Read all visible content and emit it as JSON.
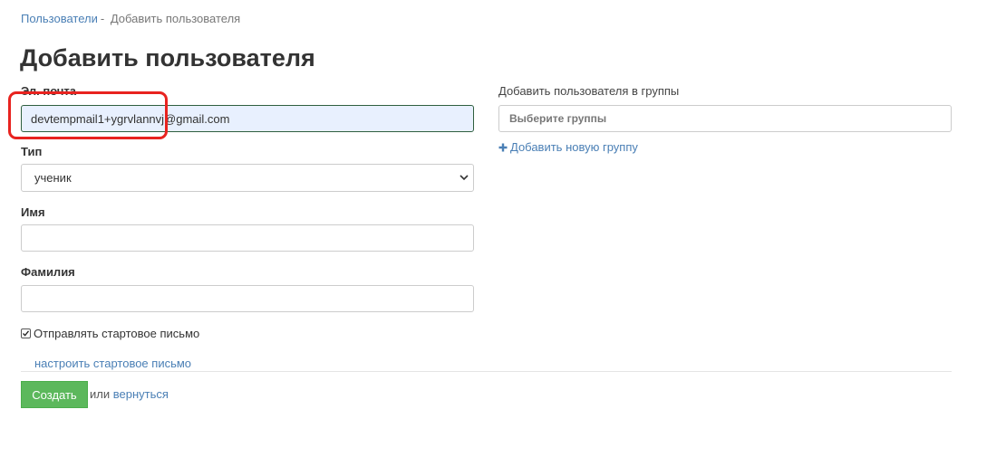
{
  "breadcrumb": {
    "parent": "Пользователи",
    "separator": "-",
    "current": "Добавить пользователя"
  },
  "page_title": "Добавить пользователя",
  "form": {
    "email": {
      "label": "Эл. почта",
      "value": "devtempmail1+ygrvlannvj@gmail.com"
    },
    "type": {
      "label": "Тип",
      "selected": "ученик"
    },
    "first_name": {
      "label": "Имя",
      "value": ""
    },
    "last_name": {
      "label": "Фамилия",
      "value": ""
    },
    "send_welcome": {
      "label": "Отправлять стартовое письмо",
      "checked": true
    },
    "configure_welcome_link": "настроить стартовое письмо"
  },
  "groups": {
    "label": "Добавить пользователя в группы",
    "placeholder": "Выберите группы",
    "add_new_label": "Добавить новую группу"
  },
  "actions": {
    "create_label": "Создать",
    "or_text": "или",
    "back_label": "вернуться"
  },
  "colors": {
    "link": "#4a7fb5",
    "primary_button": "#5cb85c",
    "highlight": "#e8231f",
    "autofill_bg": "#e8f0fe"
  }
}
